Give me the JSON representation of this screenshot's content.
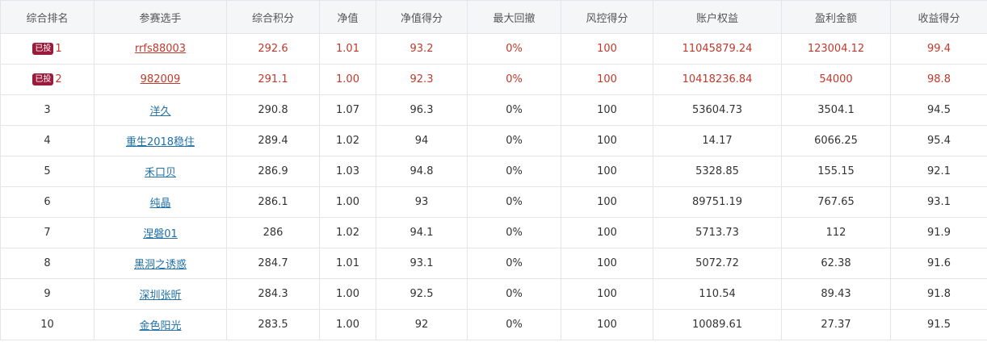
{
  "headers": [
    "综合排名",
    "参赛选手",
    "综合积分",
    "净值",
    "净值得分",
    "最大回撤",
    "风控得分",
    "账户权益",
    "盈利金额",
    "收益得分"
  ],
  "rows": [
    {
      "badge": "已投",
      "rank": "1",
      "player": "rrfs88003",
      "score": "292.6",
      "nav": "1.01",
      "nav_score": "93.2",
      "max_drawdown": "0%",
      "risk_score": "100",
      "equity": "11045879.24",
      "profit": "123004.12",
      "return_score": "99.4"
    },
    {
      "badge": "已投",
      "rank": "2",
      "player": "982009",
      "score": "291.1",
      "nav": "1.00",
      "nav_score": "92.3",
      "max_drawdown": "0%",
      "risk_score": "100",
      "equity": "10418236.84",
      "profit": "54000",
      "return_score": "98.8"
    },
    {
      "rank": "3",
      "player": "洋久",
      "score": "290.8",
      "nav": "1.07",
      "nav_score": "96.3",
      "max_drawdown": "0%",
      "risk_score": "100",
      "equity": "53604.73",
      "profit": "3504.1",
      "return_score": "94.5"
    },
    {
      "rank": "4",
      "player": "重生2018稳住",
      "score": "289.4",
      "nav": "1.02",
      "nav_score": "94",
      "max_drawdown": "0%",
      "risk_score": "100",
      "equity": "14.17",
      "profit": "6066.25",
      "return_score": "95.4"
    },
    {
      "rank": "5",
      "player": "禾口贝",
      "score": "286.9",
      "nav": "1.03",
      "nav_score": "94.8",
      "max_drawdown": "0%",
      "risk_score": "100",
      "equity": "5328.85",
      "profit": "155.15",
      "return_score": "92.1"
    },
    {
      "rank": "6",
      "player": "纯晶",
      "score": "286.1",
      "nav": "1.00",
      "nav_score": "93",
      "max_drawdown": "0%",
      "risk_score": "100",
      "equity": "89751.19",
      "profit": "767.65",
      "return_score": "93.1"
    },
    {
      "rank": "7",
      "player": "涅磐01",
      "score": "286",
      "nav": "1.02",
      "nav_score": "94.1",
      "max_drawdown": "0%",
      "risk_score": "100",
      "equity": "5713.73",
      "profit": "112",
      "return_score": "91.9"
    },
    {
      "rank": "8",
      "player": "黑洞之诱惑",
      "score": "284.7",
      "nav": "1.01",
      "nav_score": "93.1",
      "max_drawdown": "0%",
      "risk_score": "100",
      "equity": "5072.72",
      "profit": "62.38",
      "return_score": "91.6"
    },
    {
      "rank": "9",
      "player": "深圳张昕",
      "score": "284.3",
      "nav": "1.00",
      "nav_score": "92.5",
      "max_drawdown": "0%",
      "risk_score": "100",
      "equity": "110.54",
      "profit": "89.43",
      "return_score": "91.8"
    },
    {
      "rank": "10",
      "player": "金色阳光",
      "score": "283.5",
      "nav": "1.00",
      "nav_score": "92",
      "max_drawdown": "0%",
      "risk_score": "100",
      "equity": "10089.61",
      "profit": "27.37",
      "return_score": "91.5"
    }
  ],
  "colors": {
    "highlight_text": "#c0392b",
    "link": "#1f6fa8",
    "badge_bg": "#9b1b3c",
    "header_bg": "#f5f6f8",
    "border": "#e3e5e8"
  }
}
